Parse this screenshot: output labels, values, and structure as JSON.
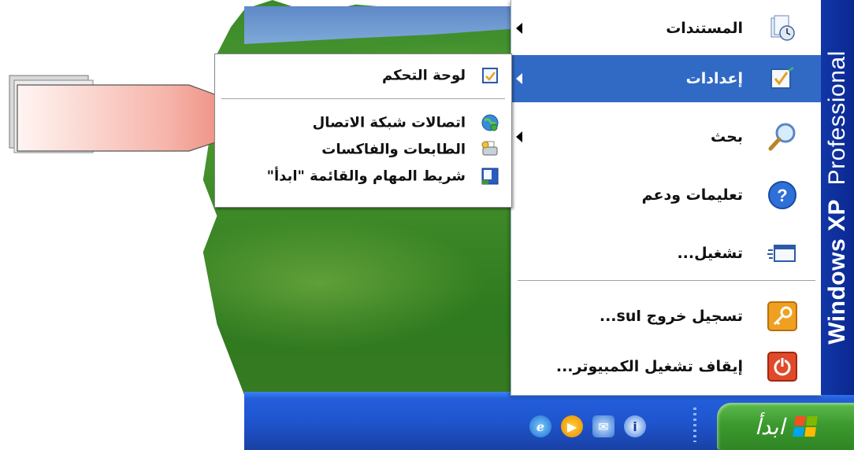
{
  "start_menu": {
    "brand": {
      "line_bold": "Windows XP",
      "line_regular": "Professional"
    },
    "items": [
      {
        "label": "المستندات",
        "icon": "documents-icon",
        "submenu": true
      },
      {
        "label": "إعدادات",
        "icon": "settings-icon",
        "submenu": true,
        "selected": true
      },
      {
        "label": "بحث",
        "icon": "search-icon",
        "submenu": true
      },
      {
        "label": "تعليمات ودعم",
        "icon": "help-icon",
        "submenu": false
      },
      {
        "label": "تشغيل...",
        "icon": "run-icon",
        "submenu": false
      },
      {
        "label": "تسجيل خروج sul...",
        "icon": "logoff-key-icon",
        "submenu": false
      },
      {
        "label": "إيقاف تشغيل الكمبيوتر...",
        "icon": "power-icon",
        "submenu": false
      }
    ]
  },
  "settings_submenu": {
    "items": [
      {
        "label": "لوحة التحكم",
        "icon": "control-panel-icon"
      },
      {
        "label": "اتصالات شبكة الاتصال",
        "icon": "network-connections-icon"
      },
      {
        "label": "الطابعات والفاكسات",
        "icon": "printers-icon"
      },
      {
        "label": "شريط المهام والقائمة \"ابدأ\"",
        "icon": "taskbar-icon"
      }
    ]
  },
  "taskbar": {
    "start_label": "ابدأ",
    "quick_launch": [
      "ie-icon",
      "media-player-icon",
      "outlook-icon",
      "info-icon"
    ]
  },
  "colors": {
    "selection": "#316ac5",
    "brand_bar": "#0a2890",
    "taskbar": "#245edb",
    "start_button": "#3c9a2e",
    "callout": "#f08a80"
  }
}
